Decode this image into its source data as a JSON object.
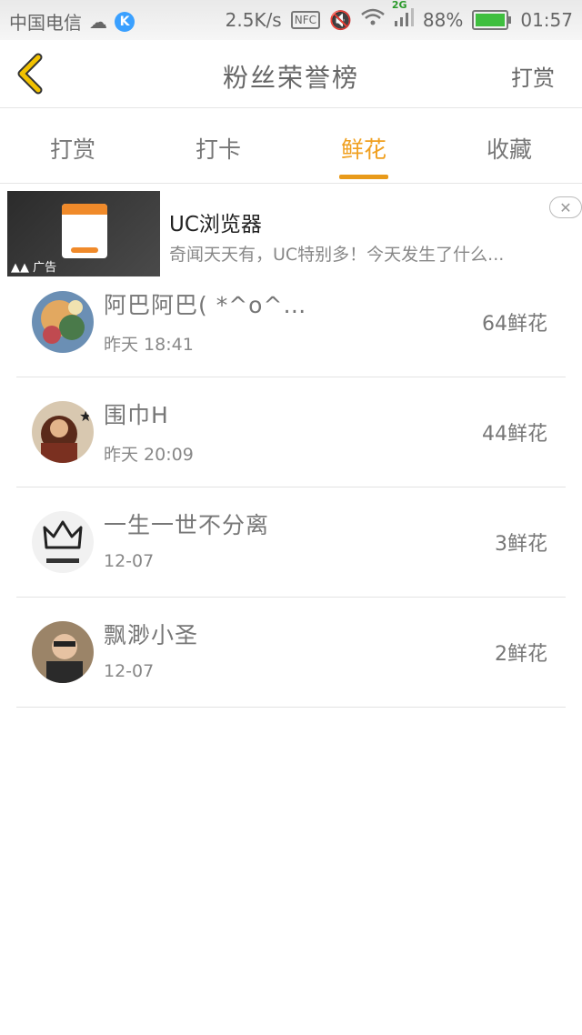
{
  "status_bar": {
    "carrier": "中国电信",
    "speed": "2.5K/s",
    "nfc": "NFC",
    "network": "2G",
    "battery": "88%",
    "battery_level": 0.88,
    "time": "01:57"
  },
  "header": {
    "title": "粉丝荣誉榜",
    "right_action": "打赏"
  },
  "tabs": [
    {
      "label": "打赏",
      "active": false
    },
    {
      "label": "打卡",
      "active": false
    },
    {
      "label": "鲜花",
      "active": true
    },
    {
      "label": "收藏",
      "active": false
    }
  ],
  "ad": {
    "title": "UC浏览器",
    "description": "奇闻天天有，UC特别多！今天发生了什么...",
    "label": "广告",
    "close": "✕"
  },
  "rows": [
    {
      "name": "阿巴阿巴(  *^o^…",
      "time": "昨天 18:41",
      "count": "64鲜花"
    },
    {
      "name": "围巾H",
      "time": "昨天 20:09",
      "count": "44鲜花"
    },
    {
      "name": "一生一世不分离",
      "time": "12-07",
      "count": "3鲜花"
    },
    {
      "name": "飘渺小圣",
      "time": "12-07",
      "count": "2鲜花"
    }
  ],
  "colors": {
    "accent": "#e89a1a",
    "back_arrow": "#f2c200"
  }
}
